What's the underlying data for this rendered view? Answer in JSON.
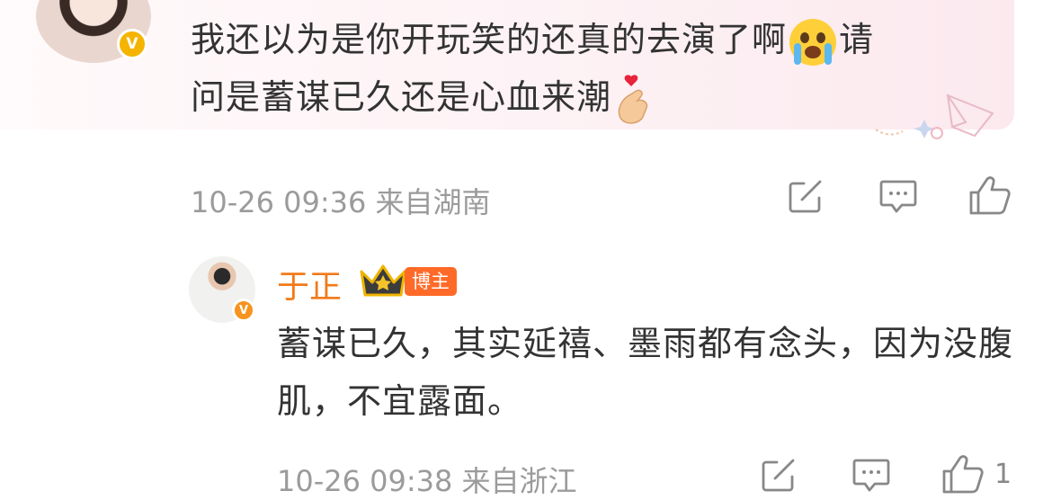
{
  "comment": {
    "text_line1": "我还以为是你开玩笑的还真的去演了啊",
    "text_line1_end": "请",
    "text_line2": "问是蓄谋已久还是心血来潮",
    "emoji_1": "loudly-crying-face",
    "emoji_2": "finger-heart",
    "timestamp": "10-26 09:36",
    "location": "来自湖南",
    "verified_badge": "V"
  },
  "reply": {
    "username": "于正",
    "host_badge": "博主",
    "text": "蓄谋已久，其实延禧、墨雨都有念头，因为没腹肌，不宜露面。",
    "timestamp": "10-26 09:38",
    "location": "来自浙江",
    "like_count": "1",
    "verified_badge": "V"
  },
  "colors": {
    "username": "#f27a1a",
    "meta_gray": "#9b9b9b",
    "badge_orange": "#ff6a28",
    "verified_gold": "#f5b400"
  },
  "icons": [
    "share-icon",
    "comment-icon",
    "like-icon",
    "crown-icon",
    "verified-icon"
  ]
}
